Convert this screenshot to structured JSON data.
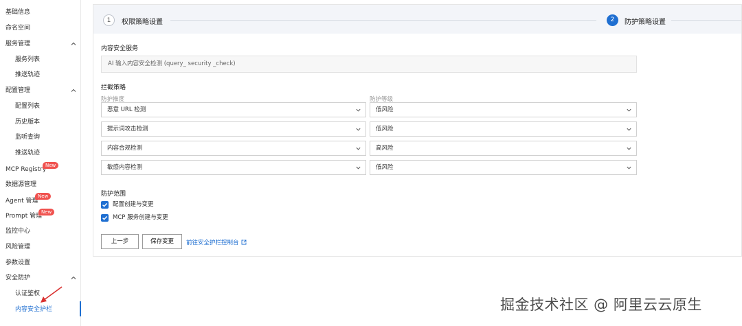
{
  "sidebar": {
    "items": [
      {
        "label": "基础信息"
      },
      {
        "label": "命名空间"
      },
      {
        "label": "服务管理"
      },
      {
        "label": "服务列表"
      },
      {
        "label": "推送轨迹"
      },
      {
        "label": "配置管理"
      },
      {
        "label": "配置列表"
      },
      {
        "label": "历史版本"
      },
      {
        "label": "监听查询"
      },
      {
        "label": "推送轨迹"
      },
      {
        "label": "MCP Registry"
      },
      {
        "label": "数据源管理"
      },
      {
        "label": "Agent 管理"
      },
      {
        "label": "Prompt 管理"
      },
      {
        "label": "监控中心"
      },
      {
        "label": "风险管理"
      },
      {
        "label": "参数设置"
      },
      {
        "label": "安全防护"
      },
      {
        "label": "认证鉴权"
      },
      {
        "label": "内容安全护栏"
      }
    ],
    "badge_label": "New",
    "active_color": "#1f6fd1",
    "badge_color": "#f0524f"
  },
  "steps": {
    "step1_number": "1",
    "step1_label": "权限策略设置",
    "step2_number": "2",
    "step2_label": "防护策略设置"
  },
  "content_service": {
    "title": "内容安全服务",
    "value": "AI 输入内容安全检测 (query_ security _check)"
  },
  "intercept": {
    "title": "拦截策略",
    "dimension_label": "防护推度",
    "level_label": "防护等级",
    "rows": [
      {
        "dimension": "恶意 URL 检测",
        "level": "低风险"
      },
      {
        "dimension": "提示词攻击检测",
        "level": "低风险"
      },
      {
        "dimension": "内容合规检测",
        "level": "高风险"
      },
      {
        "dimension": "敏感内容检测",
        "level": "低风险"
      }
    ]
  },
  "scope": {
    "title": "防护范围",
    "options": [
      {
        "label": "配置创建与变更",
        "checked": true
      },
      {
        "label": "MCP 服务创建与变更",
        "checked": true
      }
    ]
  },
  "actions": {
    "prev_label": "上一步",
    "save_label": "保存变更",
    "console_link_label": "前往安全护栏控制台"
  },
  "watermark": "掘金技术社区 @ 阿里云云原生"
}
